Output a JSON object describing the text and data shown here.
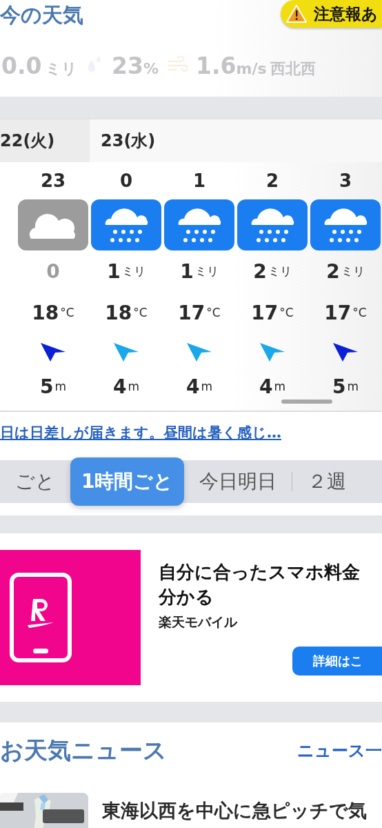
{
  "current": {
    "title": "今の天気",
    "alert": "注意報あ",
    "precip": {
      "value": "0.0",
      "unit": "ミリ"
    },
    "humidity": {
      "value": "23",
      "unit": "%"
    },
    "wind": {
      "value": "1.6",
      "unit": "m/s",
      "direction": "西北西"
    }
  },
  "forecast": {
    "days": [
      {
        "label": "22(火)",
        "selected": true
      },
      {
        "label": "23(水)",
        "selected": false
      }
    ],
    "hours": [
      {
        "hour": "23",
        "kind": "cloudy",
        "precip": "0",
        "temp": "18",
        "temp_unit": "°C",
        "wind": {
          "color": "#0a1fd6",
          "speed": "5",
          "unit": "m"
        }
      },
      {
        "hour": "0",
        "kind": "rain",
        "precip": "1",
        "precip_unit": "ミリ",
        "temp": "18",
        "temp_unit": "°C",
        "wind": {
          "color": "#1aa8ea",
          "speed": "4",
          "unit": "m"
        }
      },
      {
        "hour": "1",
        "kind": "rain",
        "precip": "1",
        "precip_unit": "ミリ",
        "temp": "17",
        "temp_unit": "°C",
        "wind": {
          "color": "#1aa8ea",
          "speed": "4",
          "unit": "m"
        }
      },
      {
        "hour": "2",
        "kind": "rain",
        "precip": "2",
        "precip_unit": "ミリ",
        "temp": "17",
        "temp_unit": "°C",
        "wind": {
          "color": "#1aa8ea",
          "speed": "4",
          "unit": "m"
        }
      },
      {
        "hour": "3",
        "kind": "rain",
        "precip": "2",
        "precip_unit": "ミリ",
        "temp": "17",
        "temp_unit": "°C",
        "wind": {
          "color": "#0a1fd6",
          "speed": "5",
          "unit": "m"
        }
      }
    ]
  },
  "summary_link": "日は日差しが届きます。昼間は暑く感じ…",
  "tabs": [
    {
      "label": "ごと",
      "selected": false
    },
    {
      "label": "1時間ごと",
      "selected": true
    },
    {
      "label": "今日明日",
      "selected": false
    },
    {
      "label": "２週",
      "selected": false
    }
  ],
  "ad": {
    "headline_1": "自分に合ったスマホ料金",
    "headline_2": "分かる",
    "advertiser": "楽天モバイル",
    "button": "詳細はこ"
  },
  "news": {
    "title": "お天気ニュース",
    "more_link": "ニュース一",
    "articles": [
      {
        "kind": "picture",
        "title": "東海以西を中心に急ピッチで気"
      }
    ]
  }
}
